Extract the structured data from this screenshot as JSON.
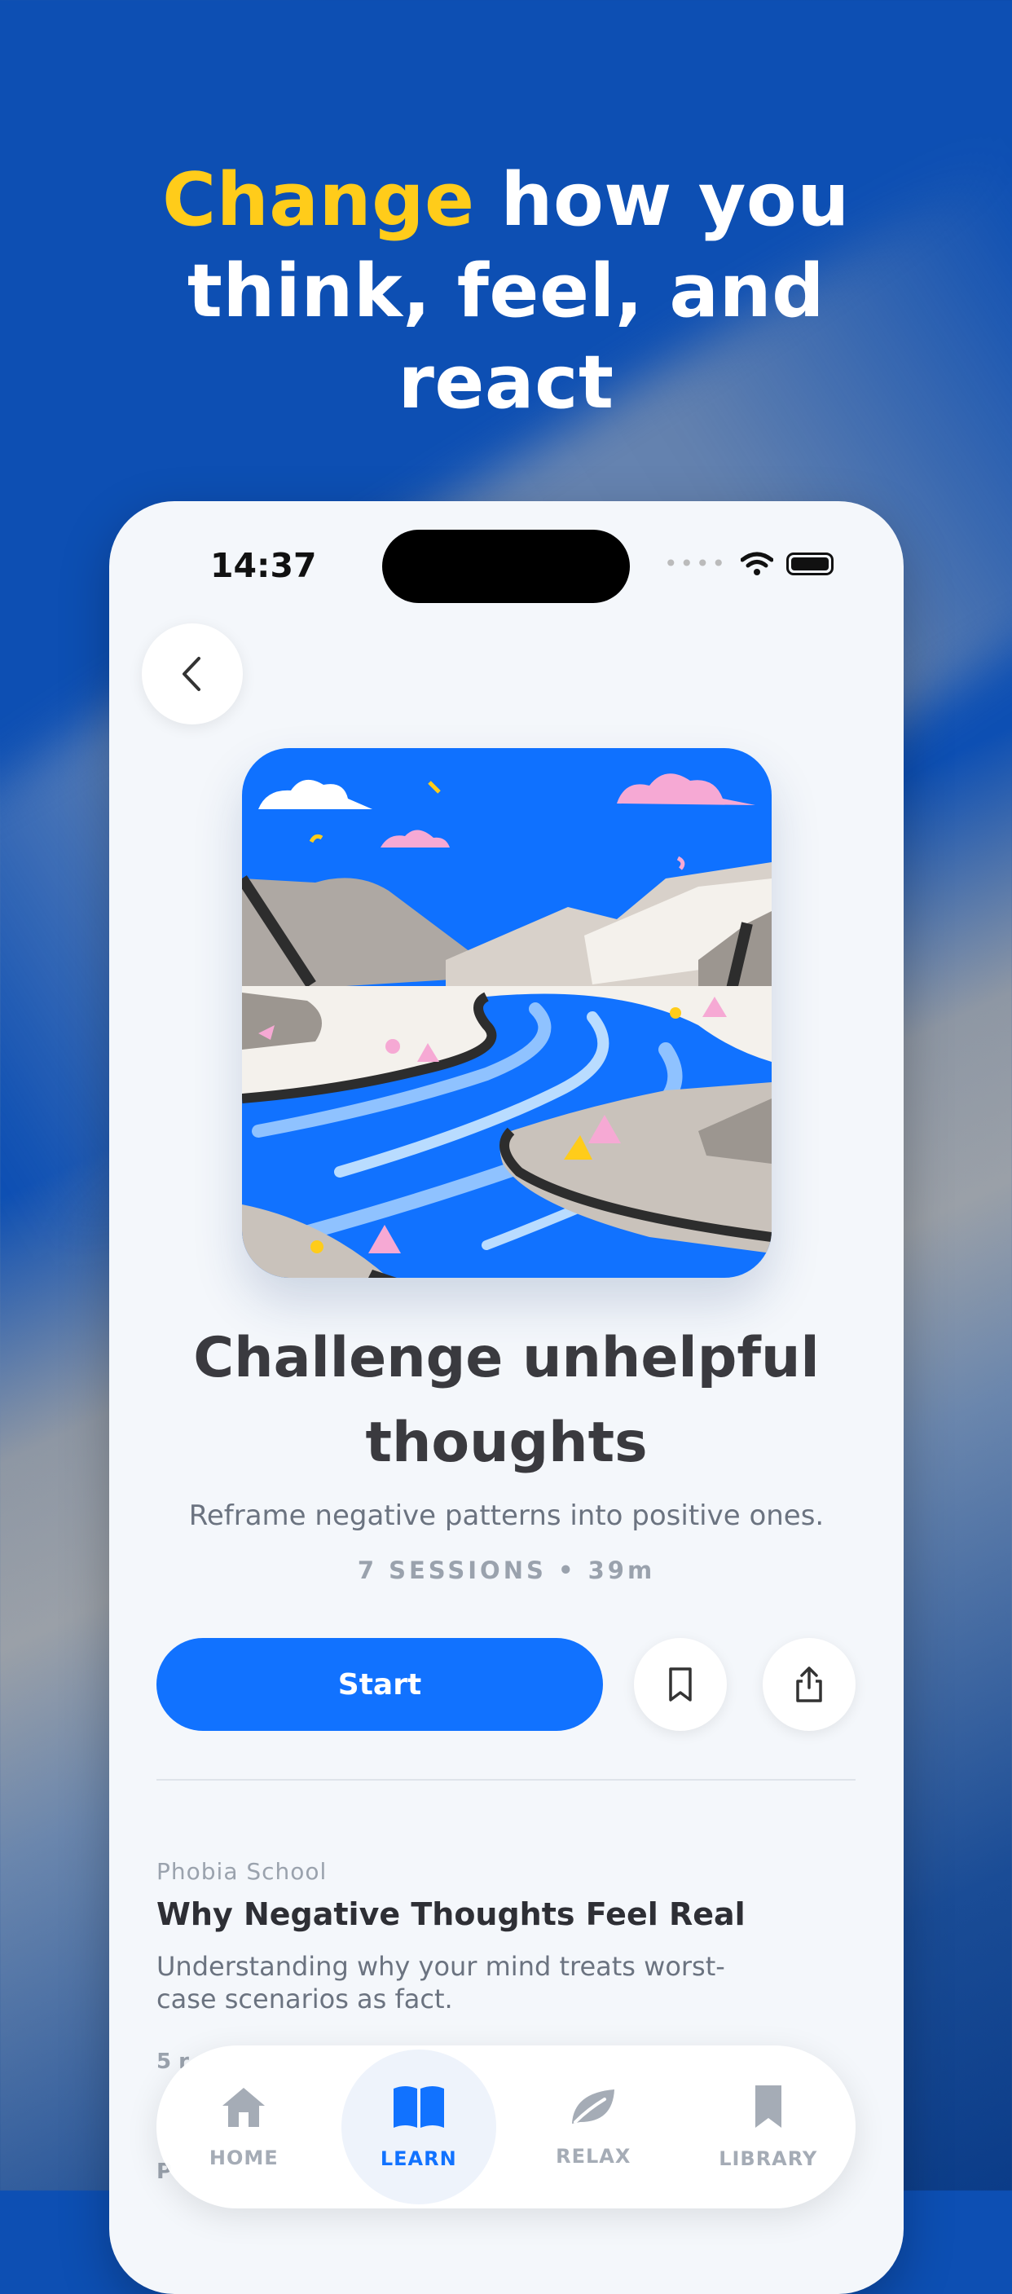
{
  "headline": {
    "accent": "Change",
    "rest_line1": " how you",
    "line2": "think, feel, and",
    "line3": "react"
  },
  "status_bar": {
    "time": "14:37"
  },
  "course": {
    "title": "Challenge unhelpful thoughts",
    "subtitle": "Reframe negative patterns into positive ones.",
    "meta": "7 SESSIONS • 39m",
    "start_label": "Start"
  },
  "session": {
    "label": "Phobia School",
    "title": "Why Negative Thoughts Feel Real",
    "description": "Understanding why your mind treats worst-case scenarios as fact.",
    "meta": "5 r",
    "meta2": "P"
  },
  "tabs": [
    {
      "label": "HOME",
      "icon": "home-icon",
      "active": false
    },
    {
      "label": "LEARN",
      "icon": "book-icon",
      "active": true
    },
    {
      "label": "RELAX",
      "icon": "leaf-icon",
      "active": false
    },
    {
      "label": "LIBRARY",
      "icon": "bookmark-icon",
      "active": false
    }
  ],
  "colors": {
    "accent_yellow": "#ffcc1a",
    "primary_blue": "#1172ff",
    "background_blue": "#0d4fb3"
  }
}
